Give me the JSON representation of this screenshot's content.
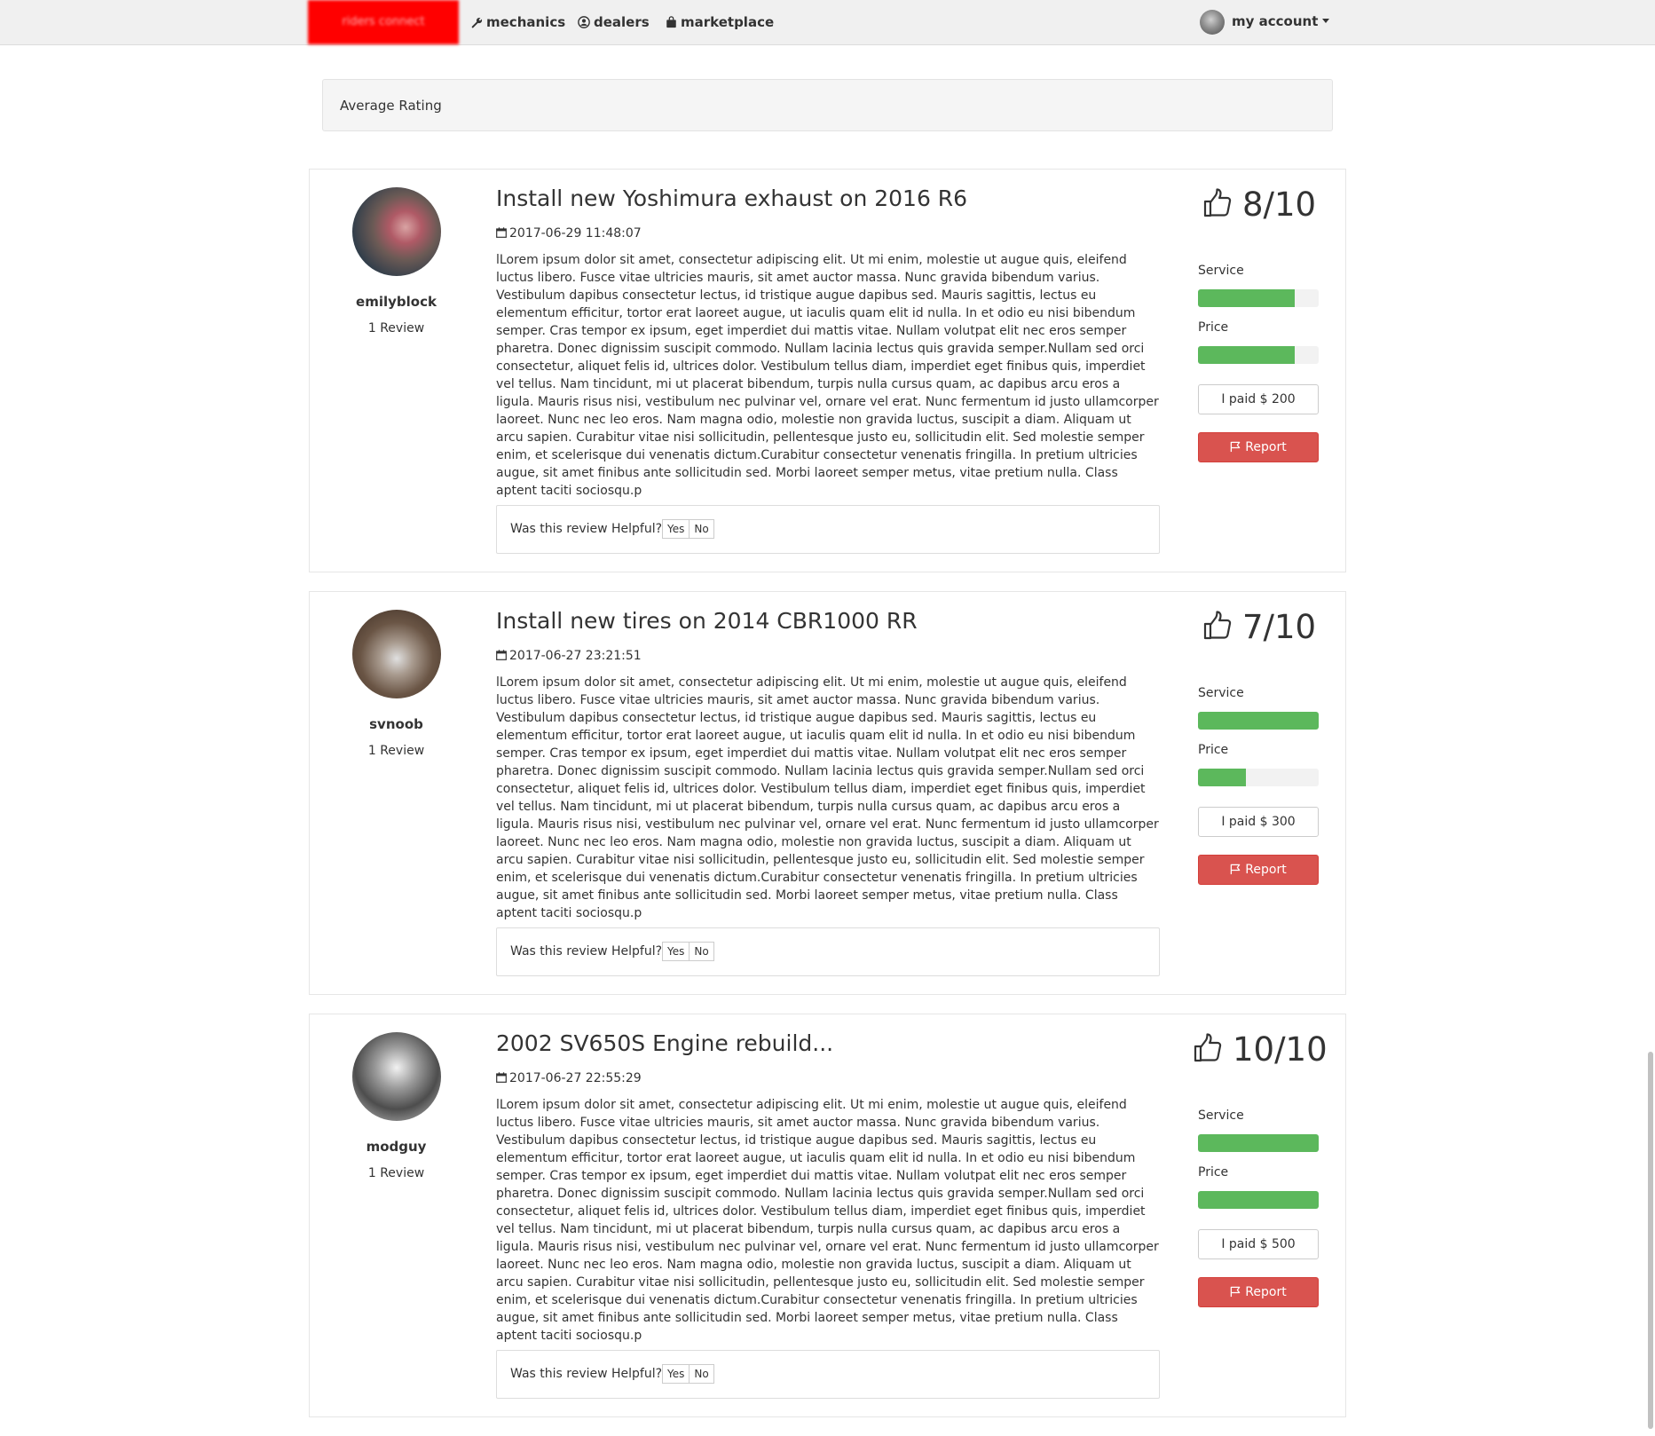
{
  "navbar": {
    "brand": "riders connect",
    "links": [
      {
        "label": "mechanics",
        "icon": "wrench-icon"
      },
      {
        "label": "dealers",
        "icon": "user-circle-icon"
      },
      {
        "label": "marketplace",
        "icon": "shopping-bag-icon"
      }
    ],
    "account_label": "my account"
  },
  "average_rating": {
    "label": "Average Rating"
  },
  "colors": {
    "brand": "#ff0000",
    "bar": "#5cb85c",
    "report": "#d9534f"
  },
  "reviews": [
    {
      "username": "emilyblock",
      "review_count": "1 Review",
      "title": "Install new Yoshimura exhaust on 2016 R6",
      "date": "2017-06-29 11:48:07",
      "body": "lLorem ipsum dolor sit amet, consectetur adipiscing elit. Ut mi enim, molestie ut augue quis, eleifend luctus libero. Fusce vitae ultricies mauris, sit amet auctor massa. Nunc gravida bibendum varius. Vestibulum dapibus consectetur lectus, id tristique augue dapibus sed. Mauris sagittis, lectus eu elementum efficitur, tortor erat laoreet augue, ut iaculis quam elit id nulla. In et odio eu nisi bibendum semper. Cras tempor ex ipsum, eget imperdiet dui mattis vitae. Nullam volutpat elit nec eros semper pharetra. Donec dignissim suscipit commodo. Nullam lacinia lectus quis gravida semper.Nullam sed orci consectetur, aliquet felis id, ultrices dolor. Vestibulum tellus diam, imperdiet eget finibus quis, imperdiet vel tellus. Nam tincidunt, mi ut placerat bibendum, turpis nulla cursus quam, ac dapibus arcu eros a ligula. Mauris risus nisi, vestibulum nec pulvinar vel, ornare vel erat. Nunc fermentum id justo ullamcorper laoreet. Nunc nec leo eros. Nam magna odio, molestie non gravida luctus, suscipit a diam. Aliquam ut arcu sapien. Curabitur vitae nisi sollicitudin, pellentesque justo eu, sollicitudin elit. Sed molestie semper enim, et scelerisque dui venenatis dictum.Curabitur consectetur venenatis fringilla. In pretium ultricies augue, sit amet finibus ante sollicitudin sed. Morbi laoreet semper metus, vitae pretium nulla. Class aptent taciti sociosqu.p",
      "score": "8/10",
      "service_label": "Service",
      "service_level": 0.8,
      "price_label": "Price",
      "price_level": 0.8,
      "paid": "I paid $ 200",
      "report_label": "Report",
      "helpful_label": "Was this review Helpful?",
      "yes_label": "Yes",
      "no_label": "No"
    },
    {
      "username": "svnoob",
      "review_count": "1 Review",
      "title": "Install new tires on 2014 CBR1000 RR",
      "date": "2017-06-27 23:21:51",
      "body": "lLorem ipsum dolor sit amet, consectetur adipiscing elit. Ut mi enim, molestie ut augue quis, eleifend luctus libero. Fusce vitae ultricies mauris, sit amet auctor massa. Nunc gravida bibendum varius. Vestibulum dapibus consectetur lectus, id tristique augue dapibus sed. Mauris sagittis, lectus eu elementum efficitur, tortor erat laoreet augue, ut iaculis quam elit id nulla. In et odio eu nisi bibendum semper. Cras tempor ex ipsum, eget imperdiet dui mattis vitae. Nullam volutpat elit nec eros semper pharetra. Donec dignissim suscipit commodo. Nullam lacinia lectus quis gravida semper.Nullam sed orci consectetur, aliquet felis id, ultrices dolor. Vestibulum tellus diam, imperdiet eget finibus quis, imperdiet vel tellus. Nam tincidunt, mi ut placerat bibendum, turpis nulla cursus quam, ac dapibus arcu eros a ligula. Mauris risus nisi, vestibulum nec pulvinar vel, ornare vel erat. Nunc fermentum id justo ullamcorper laoreet. Nunc nec leo eros. Nam magna odio, molestie non gravida luctus, suscipit a diam. Aliquam ut arcu sapien. Curabitur vitae nisi sollicitudin, pellentesque justo eu, sollicitudin elit. Sed molestie semper enim, et scelerisque dui venenatis dictum.Curabitur consectetur venenatis fringilla. In pretium ultricies augue, sit amet finibus ante sollicitudin sed. Morbi laoreet semper metus, vitae pretium nulla. Class aptent taciti sociosqu.p",
      "score": "7/10",
      "service_label": "Service",
      "service_level": 1.0,
      "price_label": "Price",
      "price_level": 0.4,
      "paid": "I paid $ 300",
      "report_label": "Report",
      "helpful_label": "Was this review Helpful?",
      "yes_label": "Yes",
      "no_label": "No"
    },
    {
      "username": "modguy",
      "review_count": "1 Review",
      "title": "2002 SV650S Engine rebuild...",
      "date": "2017-06-27 22:55:29",
      "body": "lLorem ipsum dolor sit amet, consectetur adipiscing elit. Ut mi enim, molestie ut augue quis, eleifend luctus libero. Fusce vitae ultricies mauris, sit amet auctor massa. Nunc gravida bibendum varius. Vestibulum dapibus consectetur lectus, id tristique augue dapibus sed. Mauris sagittis, lectus eu elementum efficitur, tortor erat laoreet augue, ut iaculis quam elit id nulla. In et odio eu nisi bibendum semper. Cras tempor ex ipsum, eget imperdiet dui mattis vitae. Nullam volutpat elit nec eros semper pharetra. Donec dignissim suscipit commodo. Nullam lacinia lectus quis gravida semper.Nullam sed orci consectetur, aliquet felis id, ultrices dolor. Vestibulum tellus diam, imperdiet eget finibus quis, imperdiet vel tellus. Nam tincidunt, mi ut placerat bibendum, turpis nulla cursus quam, ac dapibus arcu eros a ligula. Mauris risus nisi, vestibulum nec pulvinar vel, ornare vel erat. Nunc fermentum id justo ullamcorper laoreet. Nunc nec leo eros. Nam magna odio, molestie non gravida luctus, suscipit a diam. Aliquam ut arcu sapien. Curabitur vitae nisi sollicitudin, pellentesque justo eu, sollicitudin elit. Sed molestie semper enim, et scelerisque dui venenatis dictum.Curabitur consectetur venenatis fringilla. In pretium ultricies augue, sit amet finibus ante sollicitudin sed. Morbi laoreet semper metus, vitae pretium nulla. Class aptent taciti sociosqu.p",
      "score": "10/10",
      "service_label": "Service",
      "service_level": 1.0,
      "price_label": "Price",
      "price_level": 1.0,
      "paid": "I paid $ 500",
      "report_label": "Report",
      "helpful_label": "Was this review Helpful?",
      "yes_label": "Yes",
      "no_label": "No"
    }
  ]
}
